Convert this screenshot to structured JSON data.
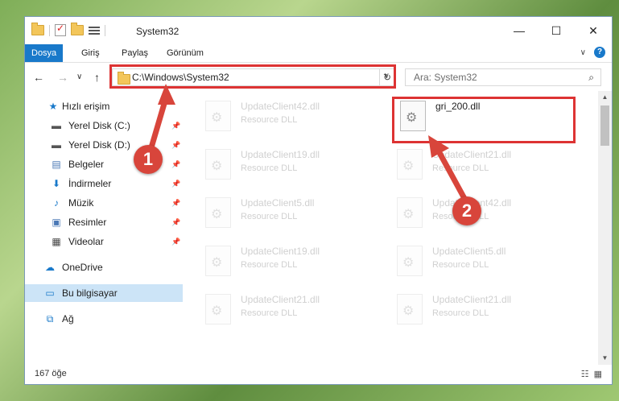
{
  "window": {
    "title": "System32"
  },
  "window_controls": {
    "minimize": "—",
    "maximize": "☐",
    "close": "✕"
  },
  "ribbon": {
    "tabs": [
      "Dosya",
      "Giriş",
      "Paylaş",
      "Görünüm"
    ],
    "active_tab": "Dosya",
    "expand_icon": "∨",
    "help": "?"
  },
  "nav": {
    "back": "←",
    "forward": "→",
    "recent": "∨",
    "up": "↑"
  },
  "address": {
    "path": "C:\\Windows\\System32",
    "dropdown": "∨",
    "refresh": "↻"
  },
  "search": {
    "placeholder": "Ara: System32",
    "icon": "⌕"
  },
  "sidebar": {
    "items": [
      {
        "label": "Hızlı erişim",
        "icon": "star-icon",
        "glyph": "★",
        "color": "#1979ca",
        "pinned": false
      },
      {
        "label": "Yerel Disk (C:)",
        "icon": "drive-icon",
        "glyph": "▬",
        "color": "#555",
        "pinned": true
      },
      {
        "label": "Yerel Disk (D:)",
        "icon": "drive-icon",
        "glyph": "▬",
        "color": "#555",
        "pinned": true
      },
      {
        "label": "Belgeler",
        "icon": "documents-icon",
        "glyph": "▤",
        "color": "#4a78b5",
        "pinned": true
      },
      {
        "label": "İndirmeler",
        "icon": "download-icon",
        "glyph": "⬇",
        "color": "#1979ca",
        "pinned": true
      },
      {
        "label": "Müzik",
        "icon": "music-icon",
        "glyph": "♪",
        "color": "#1979ca",
        "pinned": true
      },
      {
        "label": "Resimler",
        "icon": "pictures-icon",
        "glyph": "▣",
        "color": "#4a78b5",
        "pinned": true
      },
      {
        "label": "Videolar",
        "icon": "videos-icon",
        "glyph": "▦",
        "color": "#444",
        "pinned": true
      },
      {
        "label": "OneDrive",
        "icon": "cloud-icon",
        "glyph": "☁",
        "color": "#1979ca",
        "pinned": false
      },
      {
        "label": "Bu bilgisayar",
        "icon": "computer-icon",
        "glyph": "▭",
        "color": "#1979ca",
        "pinned": false
      },
      {
        "label": "Ağ",
        "icon": "network-icon",
        "glyph": "⧉",
        "color": "#1979ca",
        "pinned": false
      }
    ],
    "pin_glyph": "📌"
  },
  "files": [
    {
      "name": "UpdateClient42.dll",
      "type": "Resource DLL"
    },
    {
      "name": "gri_200.dll",
      "type": ""
    },
    {
      "name": "UpdateClient19.dll",
      "type": "Resource DLL"
    },
    {
      "name": "UpdateClient21.dll",
      "type": "Resource DLL"
    },
    {
      "name": "UpdateClient5.dll",
      "type": "Resource DLL"
    },
    {
      "name": "UpdateClient42.dll",
      "type": "Resource DLL"
    },
    {
      "name": "UpdateClient19.dll",
      "type": "Resource DLL"
    },
    {
      "name": "UpdateClient5.dll",
      "type": "Resource DLL"
    },
    {
      "name": "UpdateClient21.dll",
      "type": "Resource DLL"
    },
    {
      "name": "UpdateClient21.dll",
      "type": "Resource DLL"
    }
  ],
  "status": {
    "count": "167 öğe",
    "details_view": "☷",
    "icons_view": "▦"
  },
  "annotations": {
    "step1": "1",
    "step2": "2",
    "color": "#d8453b"
  }
}
